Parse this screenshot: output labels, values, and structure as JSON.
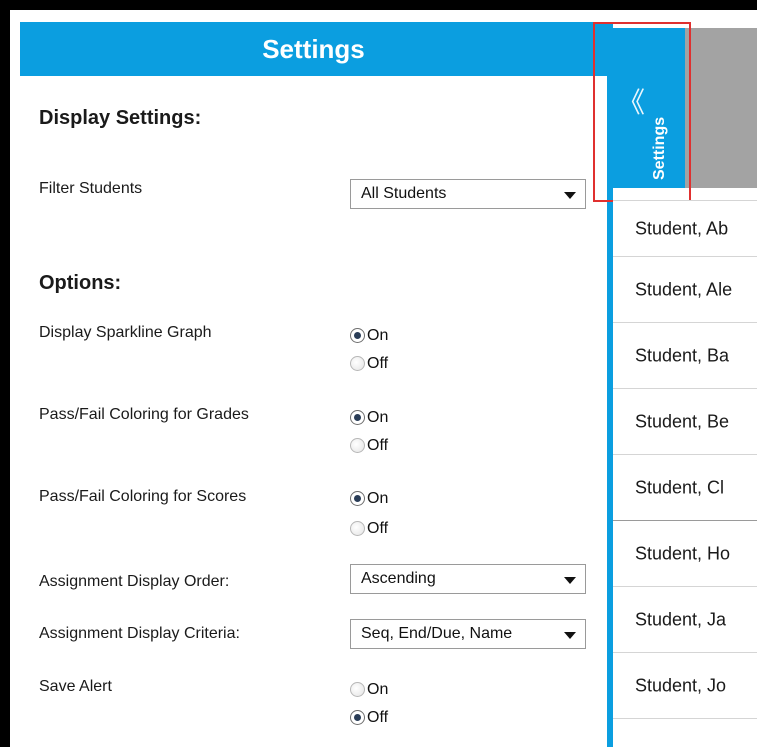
{
  "panel": {
    "title": "Settings",
    "display_settings": {
      "heading": "Display Settings:",
      "filter_label": "Filter Students",
      "filter_value": "All Students"
    },
    "options": {
      "heading": "Options:",
      "sparkline": {
        "label": "Display Sparkline Graph",
        "on": "On",
        "off": "Off",
        "selected": "On"
      },
      "grades_coloring": {
        "label": "Pass/Fail Coloring for Grades",
        "on": "On",
        "off": "Off",
        "selected": "On"
      },
      "scores_coloring": {
        "label": "Pass/Fail Coloring for Scores",
        "on": "On",
        "off": "Off",
        "selected": "On"
      },
      "display_order": {
        "label": "Assignment Display Order:",
        "value": "Ascending"
      },
      "display_criteria": {
        "label": "Assignment Display Criteria:",
        "value": "Seq, End/Due, Name"
      },
      "save_alert": {
        "label": "Save Alert",
        "on": "On",
        "off": "Off",
        "selected": "Off"
      }
    }
  },
  "tab": {
    "label": "Settings",
    "icon": "double-chevron-left-icon"
  },
  "students": [
    "Student, Ab",
    "Student, Ale",
    "Student, Ba",
    "Student, Be",
    "Student, Cl",
    "Student, Ho",
    "Student, Ja",
    "Student, Jo"
  ],
  "colors": {
    "accent": "#0b9ee0",
    "highlight": "#e0302f",
    "header_gray": "#a3a3a3"
  }
}
